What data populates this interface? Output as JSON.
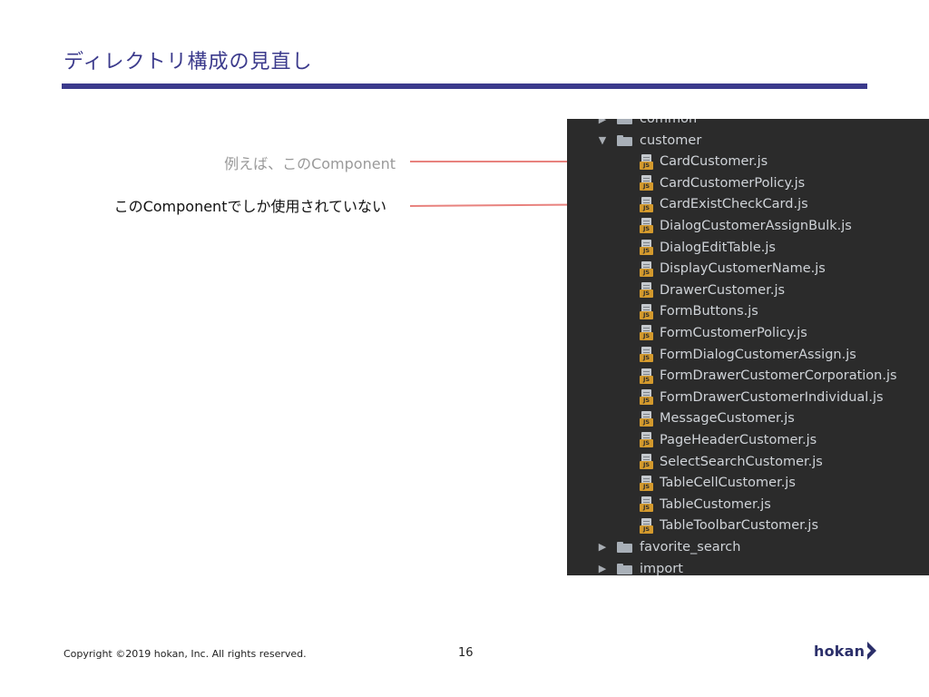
{
  "slide": {
    "title": "ディレクトリ構成の見直し",
    "label_example": "例えば、このComponent",
    "label_used_only": "このComponentでしか使用されていない",
    "copyright": "Copyright ©2019 hokan, Inc. All rights reserved.",
    "page_number": "16",
    "logo_text": "hokan"
  },
  "colors": {
    "title": "#3b3a8c",
    "arrow": "#e8827e",
    "tree_bg": "#2b2b2b",
    "js_badge": "#d49a2d"
  },
  "tree": {
    "items": [
      {
        "label": "common",
        "kind": "folder",
        "expanded": false
      },
      {
        "label": "customer",
        "kind": "folder",
        "expanded": true
      },
      {
        "label": "CardCustomer.js",
        "kind": "file",
        "icon": "js-file-icon"
      },
      {
        "label": "CardCustomerPolicy.js",
        "kind": "file",
        "icon": "js-file-icon"
      },
      {
        "label": "CardExistCheckCard.js",
        "kind": "file",
        "icon": "js-file-icon"
      },
      {
        "label": "DialogCustomerAssignBulk.js",
        "kind": "file",
        "icon": "js-file-icon"
      },
      {
        "label": "DialogEditTable.js",
        "kind": "file",
        "icon": "js-file-icon"
      },
      {
        "label": "DisplayCustomerName.js",
        "kind": "file",
        "icon": "js-file-icon"
      },
      {
        "label": "DrawerCustomer.js",
        "kind": "file",
        "icon": "js-file-icon"
      },
      {
        "label": "FormButtons.js",
        "kind": "file",
        "icon": "js-file-icon"
      },
      {
        "label": "FormCustomerPolicy.js",
        "kind": "file",
        "icon": "js-file-icon"
      },
      {
        "label": "FormDialogCustomerAssign.js",
        "kind": "file",
        "icon": "js-file-icon"
      },
      {
        "label": "FormDrawerCustomerCorporation.js",
        "kind": "file",
        "icon": "js-file-icon"
      },
      {
        "label": "FormDrawerCustomerIndividual.js",
        "kind": "file",
        "icon": "js-file-icon"
      },
      {
        "label": "MessageCustomer.js",
        "kind": "file",
        "icon": "js-file-icon"
      },
      {
        "label": "PageHeaderCustomer.js",
        "kind": "file",
        "icon": "js-file-icon"
      },
      {
        "label": "SelectSearchCustomer.js",
        "kind": "file",
        "icon": "js-file-icon"
      },
      {
        "label": "TableCellCustomer.js",
        "kind": "file",
        "icon": "js-file-icon"
      },
      {
        "label": "TableCustomer.js",
        "kind": "file",
        "icon": "js-file-icon"
      },
      {
        "label": "TableToolbarCustomer.js",
        "kind": "file",
        "icon": "js-file-icon"
      },
      {
        "label": "favorite_search",
        "kind": "folder",
        "expanded": false
      },
      {
        "label": "import",
        "kind": "folder",
        "expanded": false
      }
    ]
  }
}
